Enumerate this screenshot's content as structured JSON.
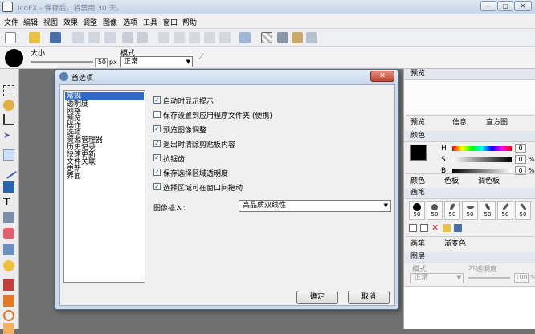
{
  "window": {
    "title": "IcoFX - 保存后，将禁用 30 天。",
    "min": "—",
    "max": "▢",
    "close": "✕"
  },
  "menu": [
    "文件",
    "编辑",
    "视图",
    "效果",
    "调整",
    "图像",
    "选项",
    "工具",
    "窗口",
    "帮助"
  ],
  "optbar": {
    "size_label": "大小",
    "size_value": "50",
    "size_unit": "px",
    "mode_label": "模式",
    "mode_value": "正常"
  },
  "dialog": {
    "title": "首选项",
    "close": "✕",
    "categories": [
      "常规",
      "透明度",
      "网格",
      "预览",
      "操作",
      "选项",
      "资源管理器",
      "历史记录",
      "快速更新",
      "文件关联",
      "更新",
      "界面"
    ],
    "selected_category": "常规",
    "options": [
      {
        "label": "启动时显示提示",
        "checked": true
      },
      {
        "label": "保存设置到应用程序文件夹 (便携)",
        "checked": false
      },
      {
        "label": "预览图像调整",
        "checked": true
      },
      {
        "label": "退出时清除剪贴板内容",
        "checked": true
      },
      {
        "label": "抗锯齿",
        "checked": true
      },
      {
        "label": "保存选择区域透明度",
        "checked": true
      },
      {
        "label": "选择区域可在窗口间拖动",
        "checked": true
      }
    ],
    "interp_label": "图像插入：",
    "interp_value": "高品质双线性",
    "ok": "确定",
    "cancel": "取消"
  },
  "right": {
    "preview_title": "预览",
    "tabs1": [
      "预览",
      "信息",
      "直方图"
    ],
    "color_title": "颜色",
    "color_channels": [
      "H",
      "S",
      "B"
    ],
    "color_values": [
      "0",
      "0",
      "0"
    ],
    "color_unit": "%",
    "tabs2": [
      "颜色",
      "色板",
      "调色板"
    ],
    "brush_title": "画笔",
    "brush_sizes": [
      "50",
      "50",
      "50",
      "50",
      "50",
      "50",
      "50"
    ],
    "tabs3": [
      "画笔",
      "渐变色"
    ],
    "layers_title": "图层",
    "layers_mode_label": "模式",
    "layers_opacity_label": "不透明度",
    "layers_mode_value": "正常",
    "layers_opacity_value": "100",
    "layers_opacity_unit": "%"
  },
  "colors": {
    "accent": "#316ac5",
    "titlebar": "#c7d5e6",
    "dialog_frame": "#cfdbea",
    "canvas": "#707070"
  }
}
